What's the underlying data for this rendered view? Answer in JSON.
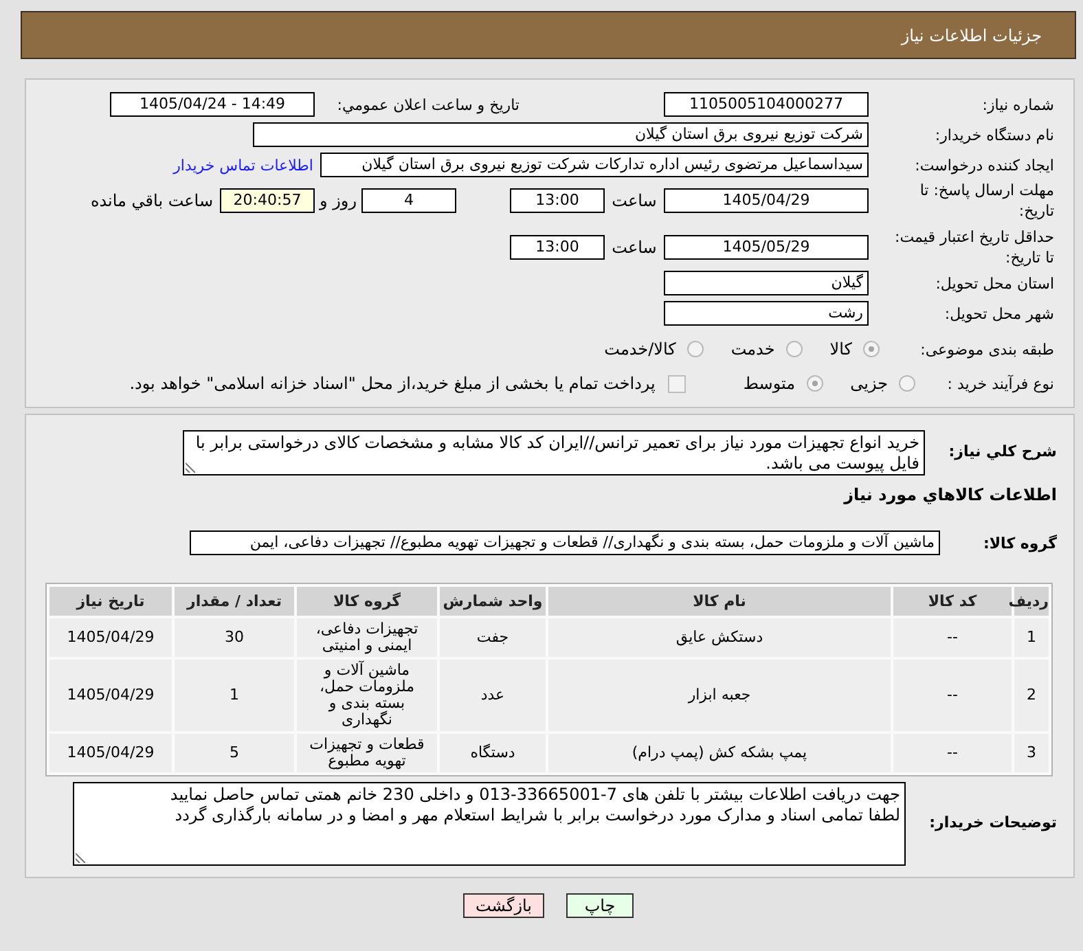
{
  "header": {
    "title": "جزئیات اطلاعات نیاز"
  },
  "details": {
    "need_number": {
      "label": "شماره نیاز:",
      "value": "1105005104000277"
    },
    "announcement": {
      "label": "تاریخ و ساعت اعلان عمومي:",
      "value": "1405/04/24 - 14:49"
    },
    "buyer_org": {
      "label": "نام دستگاه خریدار:",
      "value": "شرکت توزیع نیروی برق استان گیلان"
    },
    "requester": {
      "label": "ایجاد کننده درخواست:",
      "value": "سیداسماعیل مرتضوی رئیس اداره تدارکات شرکت توزیع نیروی برق استان گیلان",
      "contact_link": "اطلاعات تماس خریدار"
    },
    "response_deadline": {
      "label": "مهلت ارسال پاسخ: تا تاریخ:",
      "date": "1405/04/29",
      "time_label": "ساعت",
      "time": "13:00",
      "days": "4",
      "days_label": "روز و",
      "remaining": "20:40:57",
      "remaining_label": "ساعت باقي مانده"
    },
    "price_validity": {
      "label": "حداقل تاریخ اعتبار قیمت: تا تاریخ:",
      "date": "1405/05/29",
      "time_label": "ساعت",
      "time": "13:00"
    },
    "delivery_province": {
      "label": "استان محل تحویل:",
      "value": "گیلان"
    },
    "delivery_city": {
      "label": "شهر محل تحویل:",
      "value": "رشت"
    },
    "category": {
      "label": "طبقه بندی موضوعی:",
      "options": [
        {
          "label": "کالا",
          "selected": true,
          "disabled": true
        },
        {
          "label": "خدمت",
          "selected": false,
          "disabled": true
        },
        {
          "label": "کالا/خدمت",
          "selected": false,
          "disabled": true
        }
      ]
    },
    "purchase_type": {
      "label": "نوع فرآیند خرید :",
      "options": [
        {
          "label": "جزیی",
          "selected": false,
          "disabled": true
        },
        {
          "label": "متوسط",
          "selected": true,
          "disabled": true
        }
      ],
      "treasury": {
        "label": "پرداخت تمام یا بخشی از مبلغ خرید،از محل \"اسناد خزانه اسلامی\" خواهد بود.",
        "checked": false,
        "disabled": true
      }
    }
  },
  "requirements": {
    "description": {
      "label": "شرح کلي نیاز:",
      "value": "خرید انواع تجهیزات مورد نیاز برای تعمیر ترانس//ایران کد کالا مشابه و مشخصات کالای درخواستی برابر با فایل پیوست می باشد."
    },
    "goods_heading": "اطلاعات کالاهاي مورد نیاز",
    "goods_group": {
      "label": "گروه کالا:",
      "value": "ماشین آلات و ملزومات حمل، بسته بندی و نگهداری//  قطعات و تجهیزات تهویه مطبوع// تجهیزات دفاعی، ایمن"
    },
    "table": {
      "columns": [
        "ردیف",
        "کد کالا",
        "نام کالا",
        "واحد شمارش",
        "گروه کالا",
        "تعداد / مقدار",
        "تاریخ نیاز"
      ],
      "rows": [
        [
          "1",
          "--",
          "دستکش عایق",
          "جفت",
          "تجهیزات دفاعی، ایمنی و امنیتی",
          "30",
          "1405/04/29"
        ],
        [
          "2",
          "--",
          "جعبه ابزار",
          "عدد",
          "ماشین آلات و ملزومات حمل، بسته بندی و نگهداری",
          "1",
          "1405/04/29"
        ],
        [
          "3",
          "--",
          "پمپ بشکه کش (پمپ درام)",
          "دستگاه",
          "قطعات و تجهیزات تهویه مطبوع",
          "5",
          "1405/04/29"
        ]
      ]
    },
    "buyer_notes": {
      "label": "توضیحات خریدار:",
      "lines": [
        "جهت دریافت اطلاعات بیشتر با تلفن های 7-33665001-013 و داخلی 230 خانم همتی تماس حاصل نمایید",
        "لطفا تمامی اسناد و مدارک مورد درخواست برابر با شرایط استعلام مهر و امضا و در سامانه بارگذاری گردد"
      ]
    }
  },
  "buttons": [
    {
      "label": "چاپ",
      "kind": "print"
    },
    {
      "label": "بازگشت",
      "kind": "back"
    }
  ]
}
